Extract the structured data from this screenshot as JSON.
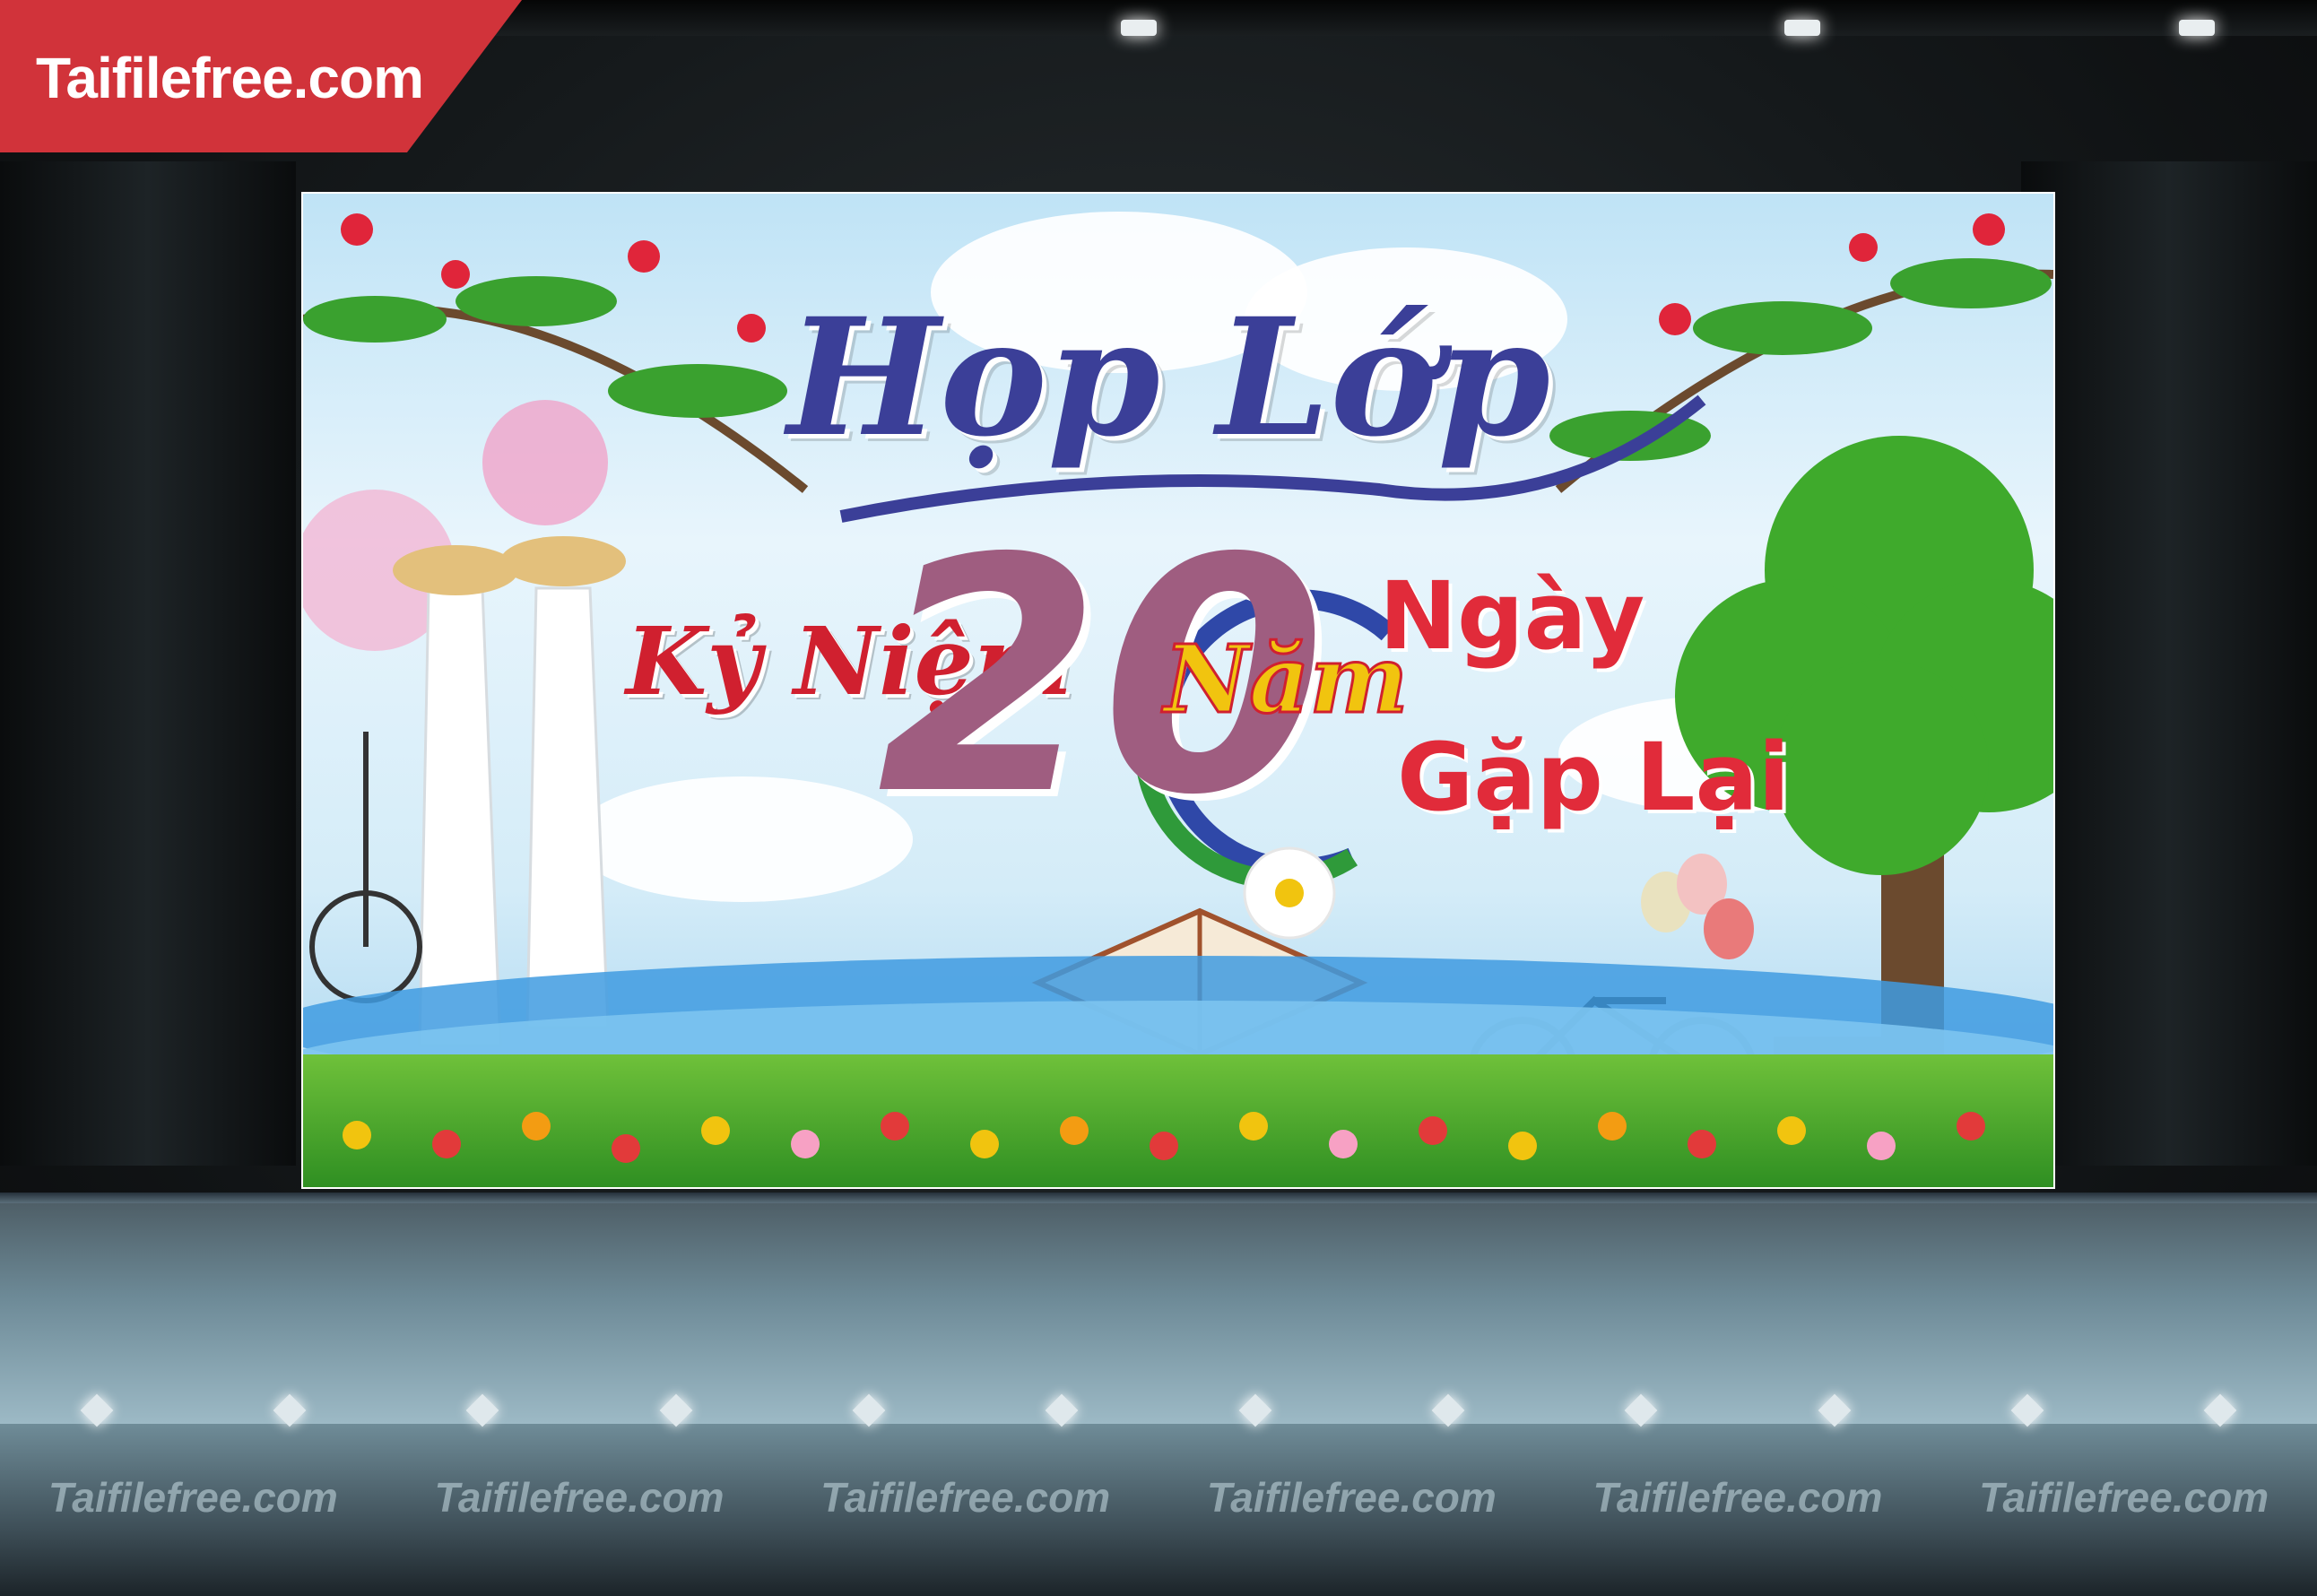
{
  "logo": {
    "text": "Taifilefree.com",
    "color": "#d1333a"
  },
  "banner": {
    "title": "Họp Lớp",
    "subtitle_left": "Kỷ Niệm",
    "number": "20",
    "unit": "Năm",
    "right_line1": "Ngày",
    "right_line2": "Gặp Lại",
    "colors": {
      "title": "#3b3f98",
      "red": "#d0202f",
      "number": "#9f5d80",
      "yellow": "#f1c40f",
      "sky": "#bfe3f6"
    }
  },
  "watermarks": [
    "Taifilefree.com",
    "Taifilefree.com",
    "Taifilefree.com",
    "Taifilefree.com",
    "Taifilefree.com",
    "Taifilefree.com"
  ]
}
